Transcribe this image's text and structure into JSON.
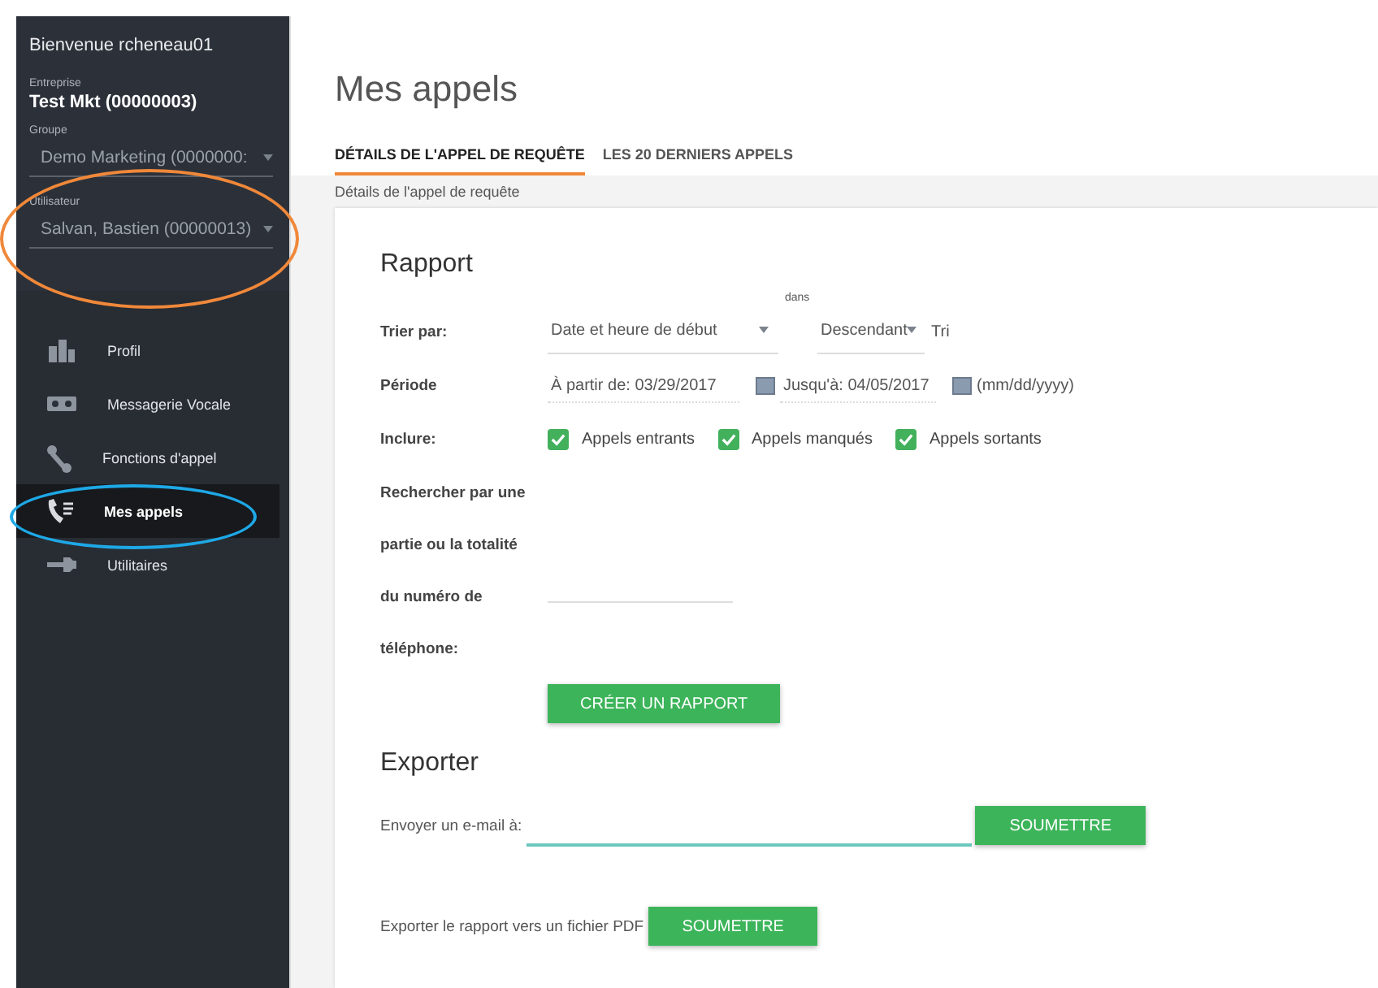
{
  "sidebar": {
    "welcome": "Bienvenue rcheneau01",
    "company": {
      "label": "Entreprise",
      "value": "Test Mkt (00000003)"
    },
    "fields": [
      {
        "label": "Groupe",
        "value": "Demo Marketing (0000000:"
      },
      {
        "label": "Utilisateur",
        "value": "Salvan, Bastien (00000013)"
      }
    ],
    "nav": [
      {
        "label": "Profil",
        "selected": false
      },
      {
        "label": "Messagerie Vocale",
        "selected": false
      },
      {
        "label": "Fonctions d'appel",
        "selected": false
      },
      {
        "label": "Mes appels",
        "selected": true
      },
      {
        "label": "Utilitaires",
        "selected": false
      }
    ]
  },
  "page_title": "Mes appels",
  "tabs": [
    {
      "label": "DÉTAILS DE L'APPEL DE REQUÊTE",
      "selected": true
    },
    {
      "label": "LES 20 DERNIERS APPELS",
      "selected": false
    }
  ],
  "breadcrumb": "Détails de l'appel de requête",
  "report": {
    "title": "Rapport",
    "sort": {
      "label": "Trier par:",
      "value": "Date et heure de début",
      "order_caption": "dans",
      "order": "Descendant",
      "suffix": "Tri"
    },
    "period": {
      "label": "Période",
      "from_label": "À partir de:",
      "from": "03/29/2017",
      "to_label": "Jusqu'à:",
      "to": "04/05/2017",
      "format": "(mm/dd/yyyy)"
    },
    "include": {
      "label": "Inclure:",
      "options": [
        {
          "label": "Appels entrants",
          "checked": true
        },
        {
          "label": "Appels manqués",
          "checked": true
        },
        {
          "label": "Appels sortants",
          "checked": true
        }
      ]
    },
    "search_label_lines": [
      "Rechercher par une",
      "partie ou la totalité",
      "du numéro de",
      "téléphone:"
    ],
    "create_button": "CRÉER UN RAPPORT"
  },
  "export": {
    "title": "Exporter",
    "email_label": "Envoyer un e-mail à:",
    "email_button": "SOUMETTRE",
    "pdf_label": "Exporter le rapport vers un fichier PDF",
    "pdf_button": "SOUMETTRE"
  }
}
